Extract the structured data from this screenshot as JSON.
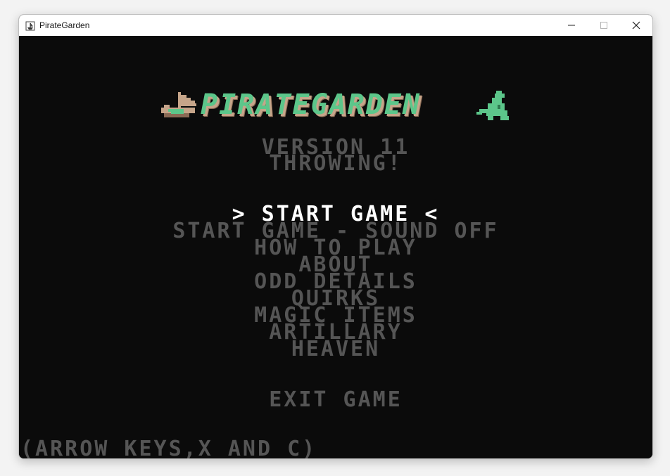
{
  "window": {
    "title": "PirateGarden"
  },
  "game": {
    "logo_text": "PIRATEGARDEN",
    "version": "VERSION 11",
    "subtitle": "THROWING!",
    "menu": [
      {
        "label": "> START GAME <",
        "selected": true
      },
      {
        "label": "START GAME - SOUND OFF",
        "selected": false
      },
      {
        "label": "HOW TO PLAY",
        "selected": false
      },
      {
        "label": "ABOUT",
        "selected": false
      },
      {
        "label": "ODD DETAILS",
        "selected": false
      },
      {
        "label": "QUIRKS",
        "selected": false
      },
      {
        "label": "MAGIC ITEMS",
        "selected": false
      },
      {
        "label": "ARTILLARY",
        "selected": false
      },
      {
        "label": "HEAVEN",
        "selected": false
      },
      {
        "label": "EXIT GAME",
        "selected": false
      }
    ],
    "controls_hint": "(ARROW KEYS,X AND C)"
  },
  "icons": {
    "app": "pirate-ship-icon",
    "minimize": "minimize-icon",
    "maximize": "maximize-icon",
    "close": "close-icon",
    "ship": "pirate-ship-icon",
    "dino": "dinosaur-icon"
  },
  "colors": {
    "background": "#0b0b0b",
    "menu_selected": "#ffffff",
    "menu_normal": "#555555",
    "logo_fill": "#5cc68a",
    "logo_shadow": "#c6a58a"
  }
}
